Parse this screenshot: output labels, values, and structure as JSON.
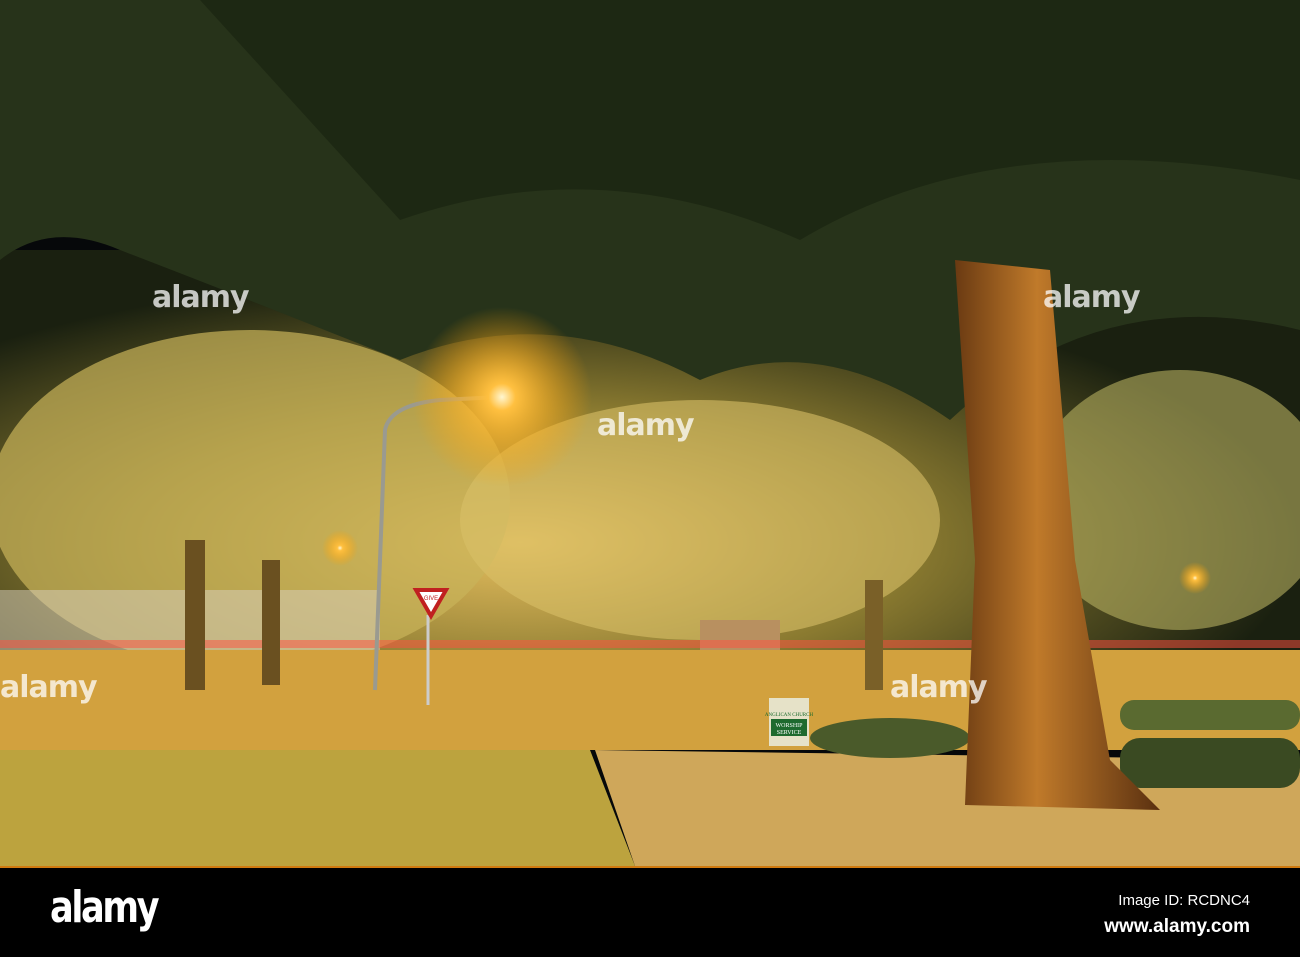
{
  "photo": {
    "description_alt": "Night street scene with large tree and street lamp",
    "sign": {
      "line1": "ANGLICAN CHURCH",
      "line2": "WORSHIP",
      "line3": "SERVICE"
    },
    "road_sign": "GIVE",
    "colors": {
      "sky": "#05070a",
      "foliage": "#2e3a1c",
      "glow": "#f0b030",
      "ground": "#c89a3a",
      "grass": "#b39a3c"
    }
  },
  "watermark": {
    "text": "alamy"
  },
  "footer": {
    "logo": "alamy",
    "image_id": "Image ID: RCDNC4",
    "url": "www.alamy.com"
  }
}
